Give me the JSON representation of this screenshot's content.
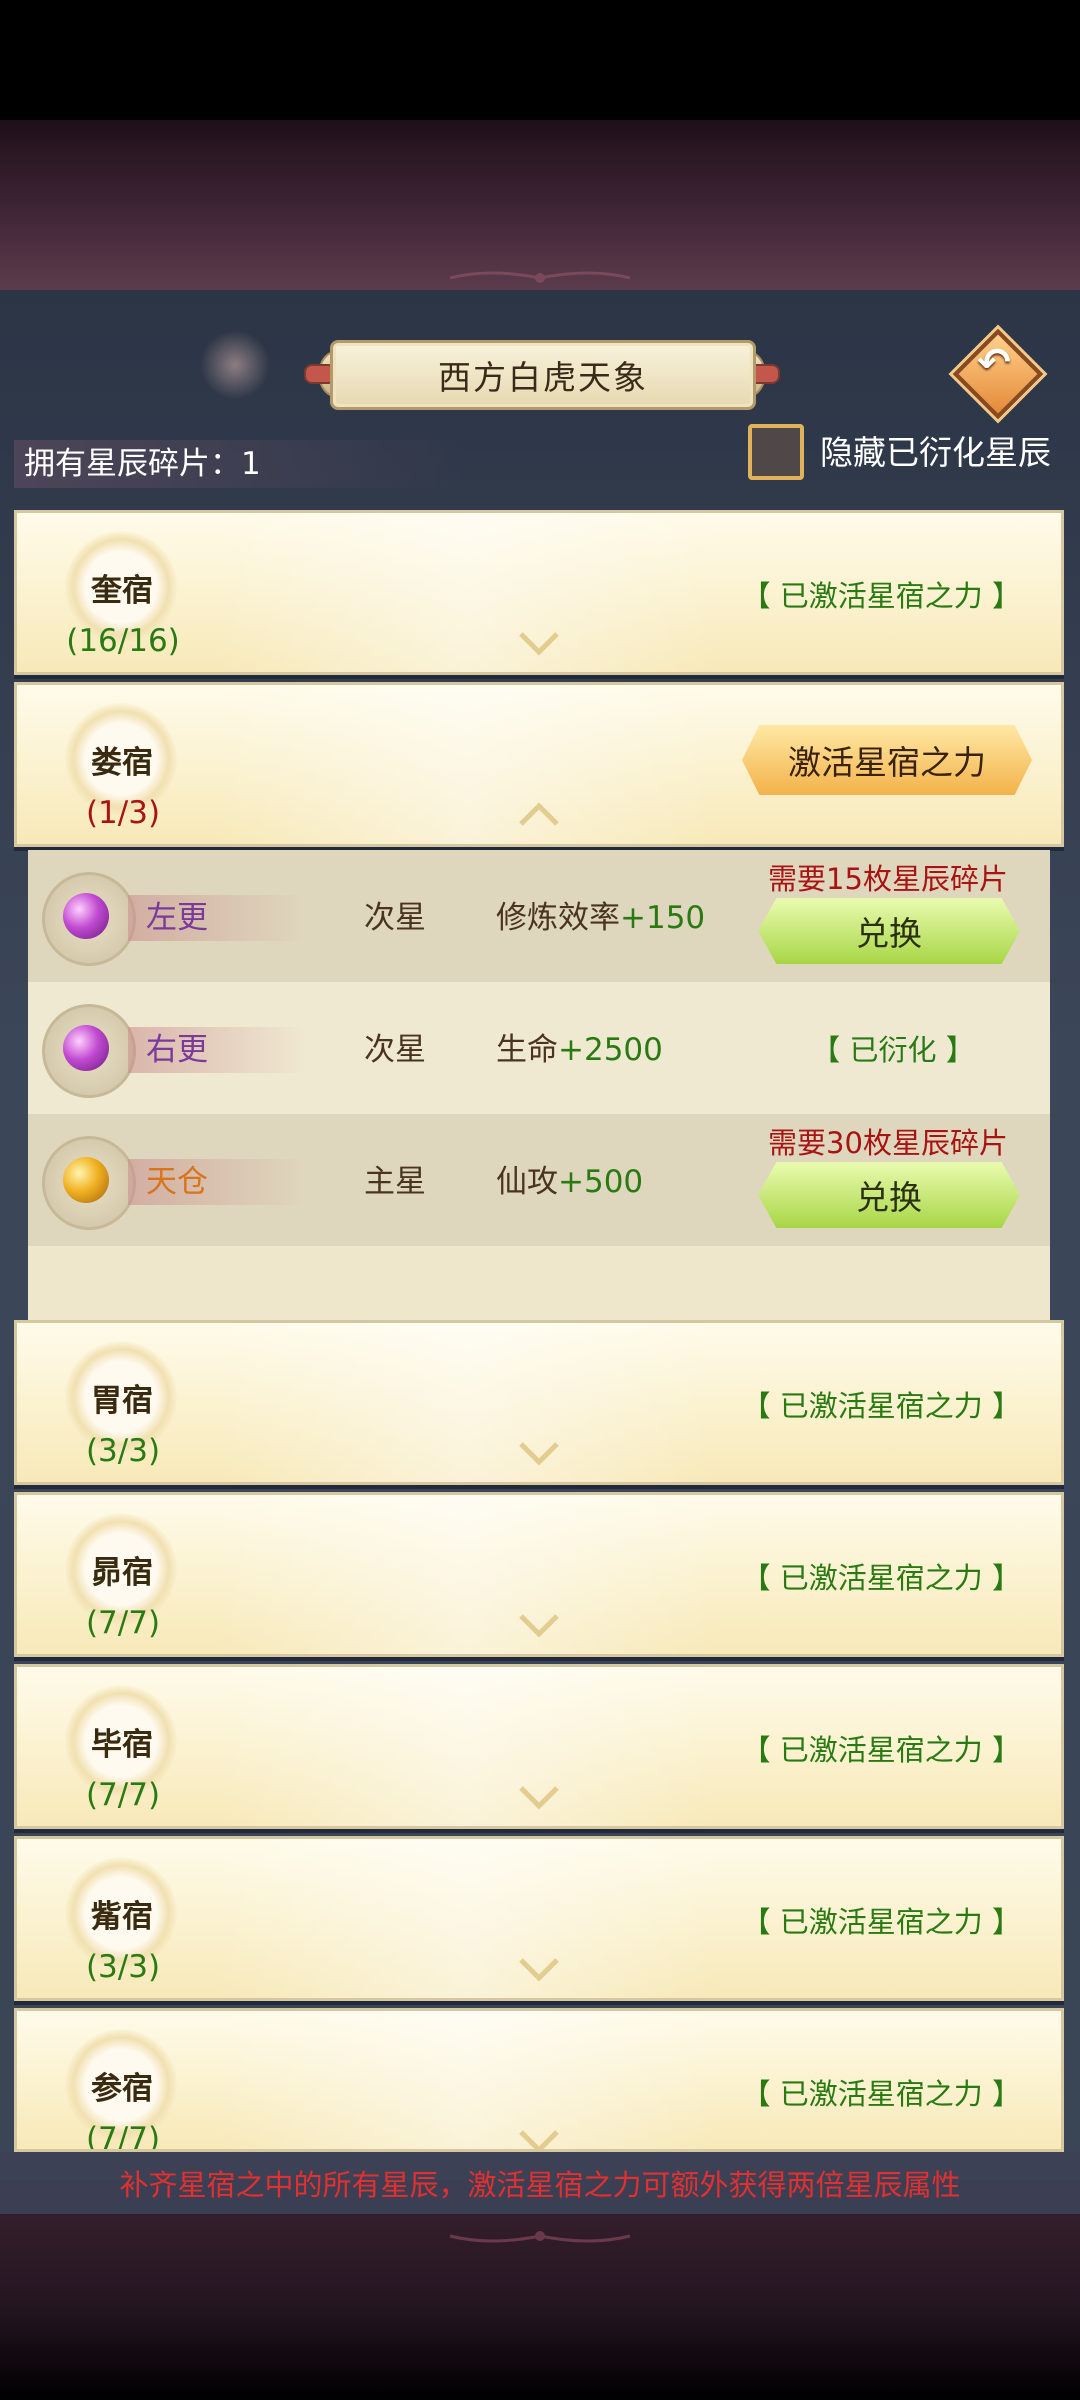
{
  "header": {
    "title": "西方白虎天象",
    "back_icon": "back-arrow-icon"
  },
  "owned": {
    "label": "拥有星辰碎片：",
    "value": "1"
  },
  "hide_toggle": {
    "label": "隐藏已衍化星辰",
    "checked": false
  },
  "mansions": [
    {
      "name": "奎宿",
      "count": "(16/16)",
      "status": "【 已激活星宿之力 】",
      "expanded": false
    },
    {
      "name": "娄宿",
      "count": "(1/3)",
      "button": "激活星宿之力",
      "expanded": true
    },
    {
      "name": "胃宿",
      "count": "(3/3)",
      "status": "【 已激活星宿之力 】",
      "expanded": false
    },
    {
      "name": "昴宿",
      "count": "(7/7)",
      "status": "【 已激活星宿之力 】",
      "expanded": false
    },
    {
      "name": "毕宿",
      "count": "(7/7)",
      "status": "【 已激活星宿之力 】",
      "expanded": false
    },
    {
      "name": "觜宿",
      "count": "(3/3)",
      "status": "【 已激活星宿之力 】",
      "expanded": false
    },
    {
      "name": "参宿",
      "count": "(7/7)",
      "status": "【 已激活星宿之力 】",
      "expanded": false
    }
  ],
  "stars": [
    {
      "name": "左更",
      "type": "次星",
      "attr": "修炼效率",
      "bonus": "+150",
      "need": "需要15枚星辰碎片",
      "button": "兑换"
    },
    {
      "name": "右更",
      "type": "次星",
      "attr": "生命",
      "bonus": "+2500",
      "status": "【 已衍化 】"
    },
    {
      "name": "天仓",
      "type": "主星",
      "attr": "仙攻",
      "bonus": "+500",
      "need": "需要30枚星辰碎片",
      "button": "兑换"
    }
  ],
  "footer": {
    "text": "补齐星宿之中的所有星辰，激活星宿之力可额外获得两倍星辰属性"
  },
  "colors": {
    "complete_green": "#2a7a14",
    "incomplete_red": "#a81414",
    "name_purple": "#7a3a9a",
    "name_orange": "#d8741a"
  }
}
